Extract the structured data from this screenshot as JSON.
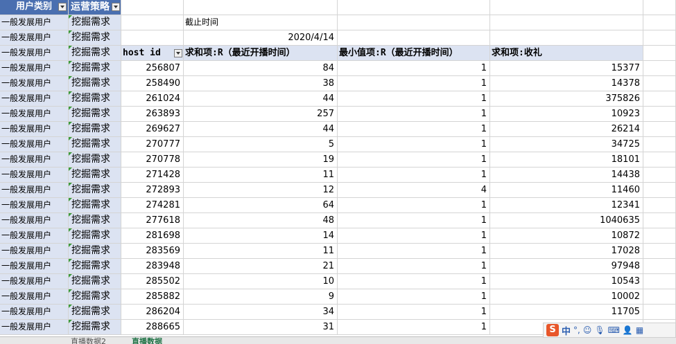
{
  "header": {
    "col_a": "用户类别",
    "col_b": "运营策略"
  },
  "left_rows": {
    "user_type": "一般发展用户",
    "strategy": "挖掘需求",
    "count": 21
  },
  "cutoff": {
    "label": "截止时间",
    "date": "2020/4/14"
  },
  "pivot_headers": [
    "host id",
    "求和项:R（最近开播时间）",
    "最小值项:R（最近开播时间）",
    "求和项:收礼"
  ],
  "pivot_rows": [
    [
      "256807",
      "84",
      "1",
      "15377"
    ],
    [
      "258490",
      "38",
      "1",
      "14378"
    ],
    [
      "261024",
      "44",
      "1",
      "375826"
    ],
    [
      "263893",
      "257",
      "1",
      "10923"
    ],
    [
      "269627",
      "44",
      "1",
      "26214"
    ],
    [
      "270777",
      "5",
      "1",
      "34725"
    ],
    [
      "270778",
      "19",
      "1",
      "18101"
    ],
    [
      "271428",
      "11",
      "1",
      "14438"
    ],
    [
      "272893",
      "12",
      "4",
      "11460"
    ],
    [
      "274281",
      "64",
      "1",
      "12341"
    ],
    [
      "277618",
      "48",
      "1",
      "1040635"
    ],
    [
      "281698",
      "14",
      "1",
      "10872"
    ],
    [
      "283569",
      "11",
      "1",
      "17028"
    ],
    [
      "283948",
      "21",
      "1",
      "97948"
    ],
    [
      "285502",
      "10",
      "1",
      "10543"
    ],
    [
      "285882",
      "9",
      "1",
      "10002"
    ],
    [
      "286204",
      "34",
      "1",
      "11705"
    ],
    [
      "288665",
      "31",
      "1",
      ""
    ]
  ],
  "tabs": [
    "直播数据2",
    "直播数据"
  ],
  "ime": {
    "logo": "S",
    "lang": "中"
  }
}
